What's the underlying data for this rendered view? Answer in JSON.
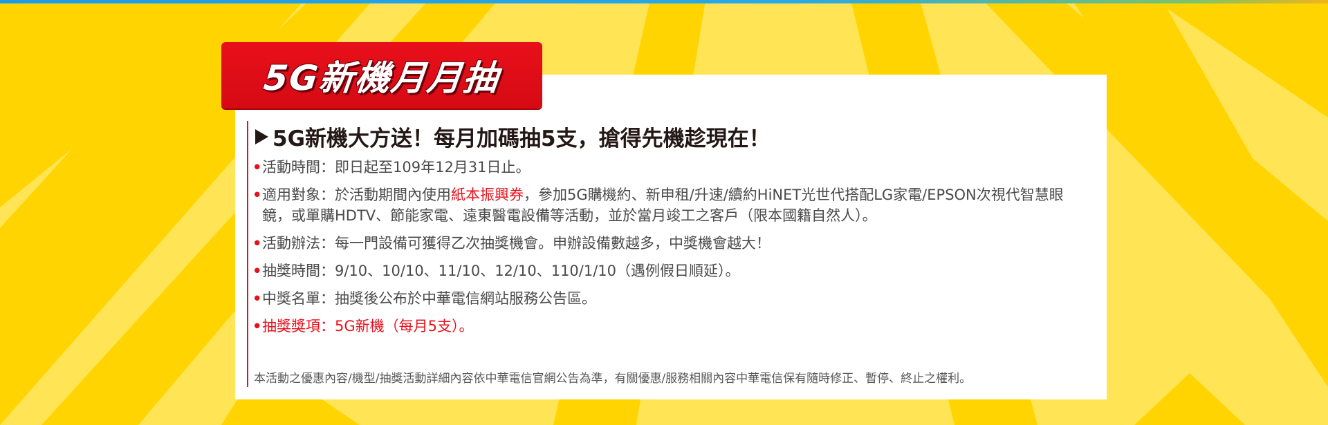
{
  "banner": {
    "title": "5G新機月月抽"
  },
  "headline": "5G新機大方送！每月加碼抽5支，搶得先機趁現在！",
  "items": [
    {
      "bullet": "•",
      "text": "活動時間：即日起至109年12月31日止。"
    },
    {
      "bullet": "•",
      "pre": "適用對象：於活動期間內使用",
      "highlight": "紙本振興券",
      "post": "，參加5G購機約、新申租/升速/續約HiNET光世代搭配LG家電/EPSON次視代智慧眼鏡，或單購HDTV、節能家電、遠東醫電設備等活動，並於當月竣工之客戶（限本國籍自然人）。"
    },
    {
      "bullet": "•",
      "text": "活動辦法：每一門設備可獲得乙次抽獎機會。申辦設備數越多，中獎機會越大！"
    },
    {
      "bullet": "•",
      "text": "抽獎時間：9/10、10/10、11/10、12/10、110/1/10（遇例假日順延）。"
    },
    {
      "bullet": "•",
      "text": "中獎名單：抽獎後公布於中華電信網站服務公告區。"
    },
    {
      "bullet": "•",
      "text": "抽獎獎項：5G新機（每月5支）。"
    }
  ],
  "footnote": "本活動之優惠內容/機型/抽獎活動詳細內容依中華電信官網公告為準，有關優惠/服務相關內容中華電信保有隨時修正、暫停、終止之權利。",
  "colors": {
    "accent_red": "#e8101a",
    "background_yellow": "#ffe04a",
    "ray_yellow": "#ffd200",
    "text_dark": "#231815"
  },
  "icons": {
    "headline_marker": "triangle-right-icon"
  }
}
